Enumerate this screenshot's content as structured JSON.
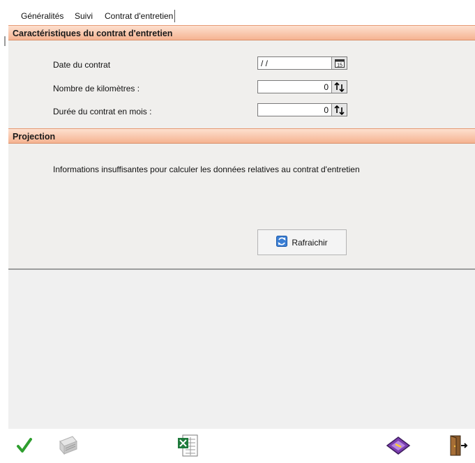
{
  "tabs": [
    {
      "label": "Généralités"
    },
    {
      "label": "Suivi"
    },
    {
      "label": "Contrat d'entretien"
    }
  ],
  "section1": {
    "title": "Caractéristiques du contrat d'entretien",
    "fields": [
      {
        "label": "Date du contrat",
        "value": "/ /"
      },
      {
        "label": "Nombre de kilomètres :",
        "value": "0"
      },
      {
        "label": "Durée du contrat en mois :",
        "value": "0"
      }
    ]
  },
  "section2": {
    "title": "Projection",
    "info": "Informations insuffisantes pour calculer les données relatives au contrat d'entretien",
    "refresh_label": "Rafraichir"
  },
  "toolbar": {
    "icons": [
      "checkmark-icon",
      "printer-icon",
      "excel-icon",
      "card-icon",
      "exit-door-icon"
    ]
  },
  "colors": {
    "header_gradient_top": "#fde0cf",
    "header_gradient_bottom": "#f5b391",
    "panel_bg": "#f0efed"
  }
}
